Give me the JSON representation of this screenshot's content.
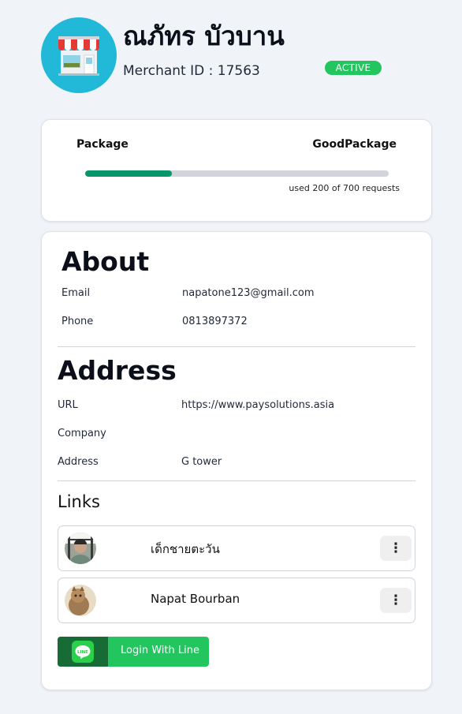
{
  "merchant": {
    "name": "ณภัทร บัวบาน",
    "merchant_id": "Merchant ID : 17563",
    "status": "ACTIVE",
    "avatar_icon": "store-icon"
  },
  "package": {
    "label": "Package",
    "name": "GoodPackage",
    "used": 200,
    "total": 700,
    "usage_text": "used 200 of 700 requests"
  },
  "about": {
    "title": "About",
    "email_label": "Email",
    "email_value": "napatone123@gmail.com",
    "phone_label": "Phone",
    "phone_value": "0813897372"
  },
  "address": {
    "title": "Address",
    "url_label": "URL",
    "url_value": "https://www.paysolutions.asia",
    "company_label": "Company",
    "company_value": "",
    "address_label": "Address",
    "address_value": "G tower"
  },
  "links": {
    "title": "Links",
    "items": [
      {
        "name": "เด็กชายตะวัน",
        "more": "⋮"
      },
      {
        "name": "Napat Bourban",
        "more": "⋮"
      }
    ]
  },
  "line_login": {
    "label": "Login With Line",
    "icon_text": "LINE"
  },
  "colors": {
    "background": "#f0f4f8",
    "avatar_bg": "#22b8d8",
    "active_badge": "#22c55e",
    "progress_fill": "#059669",
    "line_button": "#22c55e"
  }
}
